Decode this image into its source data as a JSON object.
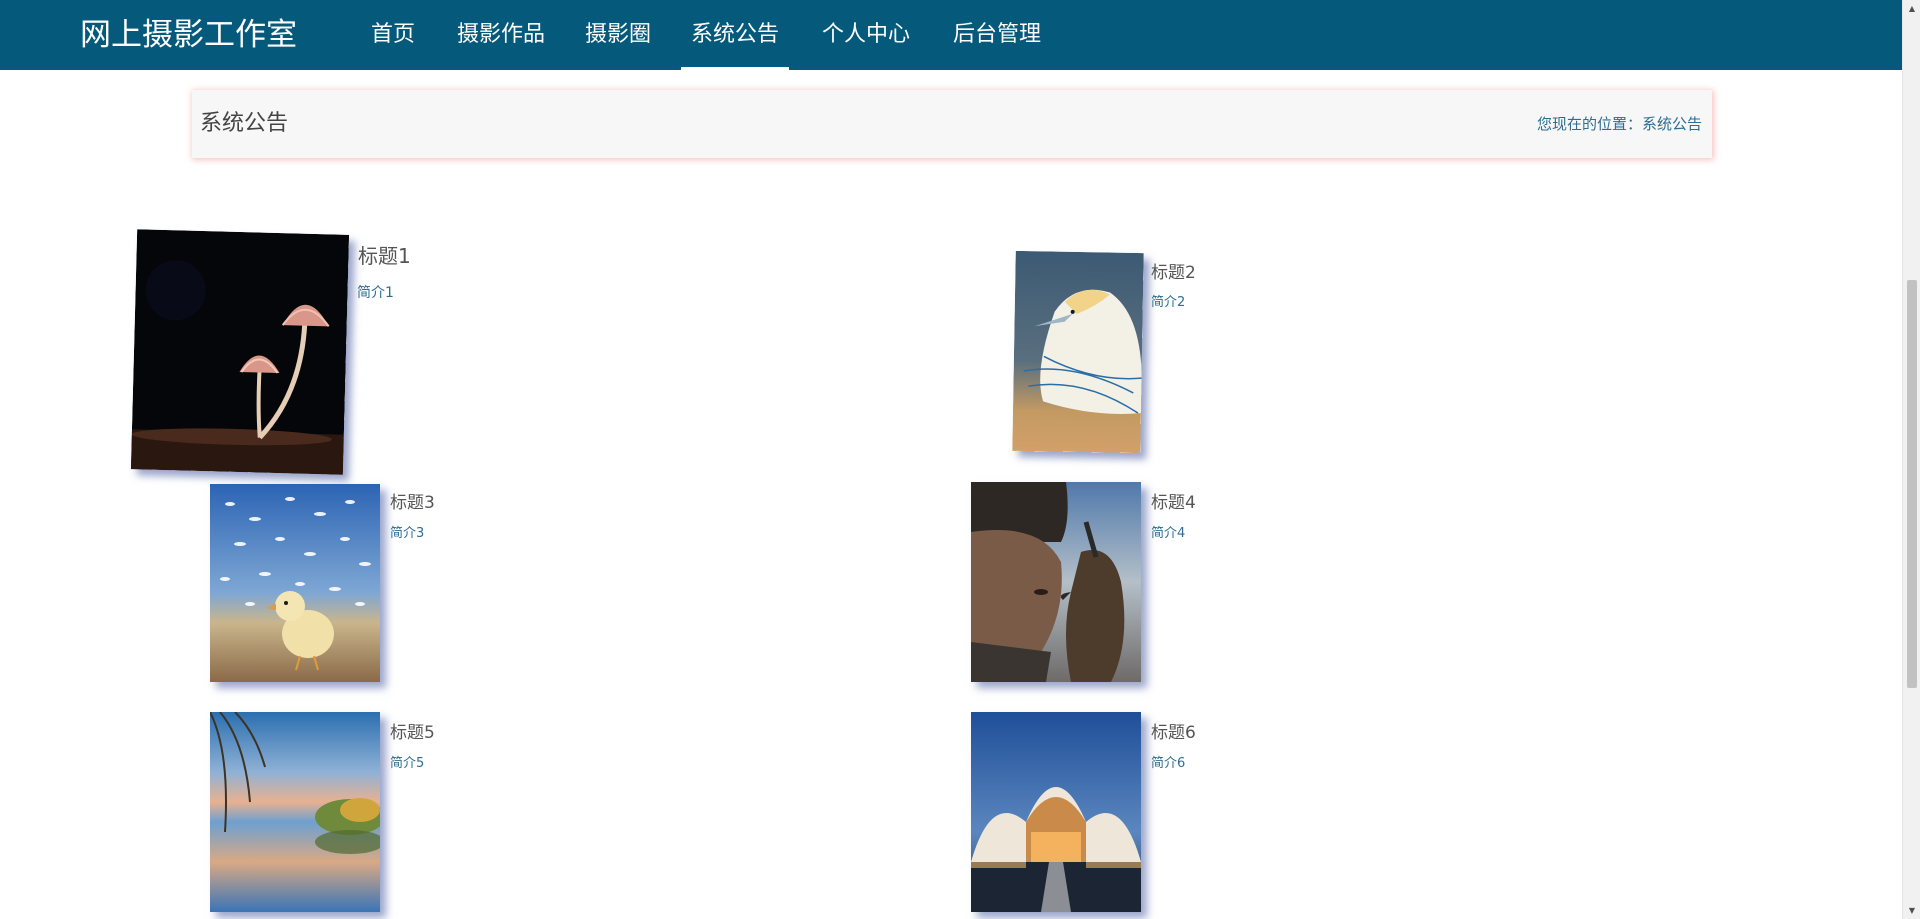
{
  "brand": "网上摄影工作室",
  "nav": [
    {
      "label": "首页"
    },
    {
      "label": "摄影作品"
    },
    {
      "label": "摄影圈"
    },
    {
      "label": "系统公告",
      "active": true
    },
    {
      "label": "个人中心"
    },
    {
      "label": "后台管理"
    }
  ],
  "header": {
    "title": "系统公告",
    "breadcrumb": "您现在的位置：系统公告"
  },
  "cards": [
    {
      "title": "标题1",
      "desc": "简介1",
      "image": "mushroom-photo"
    },
    {
      "title": "标题2",
      "desc": "简介2",
      "image": "gannet-bird-photo"
    },
    {
      "title": "标题3",
      "desc": "简介3",
      "image": "chick-and-gulls-photo"
    },
    {
      "title": "标题4",
      "desc": "简介4",
      "image": "falconer-and-eagle-photo"
    },
    {
      "title": "标题5",
      "desc": "简介5",
      "image": "lake-reflection-photo"
    },
    {
      "title": "标题6",
      "desc": "简介6",
      "image": "curved-building-at-dusk-photo"
    }
  ],
  "colors": {
    "nav_background": "#055a7c",
    "link": "#2f6d8f",
    "header_shadow": "#f09696"
  }
}
